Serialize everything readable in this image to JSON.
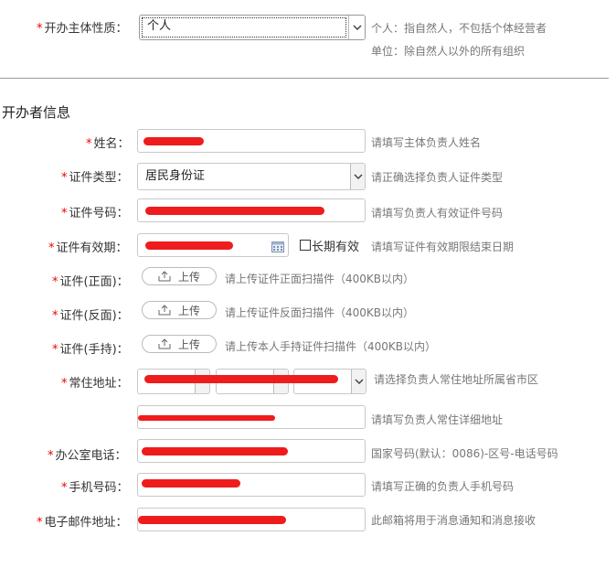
{
  "entity": {
    "label": "开办主体性质：",
    "selected": "个人",
    "hint_person": "个人：指自然人，不包括个体经营者",
    "hint_org": "单位：除自然人以外的所有组织"
  },
  "section_title": "开办者信息",
  "fields": {
    "name": {
      "label": "姓名：",
      "hint": "请填写主体负责人姓名"
    },
    "id_type": {
      "label": "证件类型：",
      "selected": "居民身份证",
      "hint": "请正确选择负责人证件类型"
    },
    "id_number": {
      "label": "证件号码：",
      "hint": "请填写负责人有效证件号码"
    },
    "id_validity": {
      "label": "证件有效期：",
      "long_term": "长期有效",
      "hint": "请填写证件有效期限结束日期"
    },
    "id_front": {
      "label": "证件(正面)：",
      "button": "上传",
      "hint": "请上传证件正面扫描件（400KB以内）"
    },
    "id_back": {
      "label": "证件(反面)：",
      "button": "上传",
      "hint": "请上传证件反面扫描件（400KB以内）"
    },
    "id_hand": {
      "label": "证件(手持)：",
      "button": "上传",
      "hint": "请上传本人手持证件扫描件（400KB以内）"
    },
    "address": {
      "label": "常住地址：",
      "hint_region": "请选择负责人常住地址所属省市区",
      "hint_detail": "请填写负责人常住详细地址"
    },
    "office_phone": {
      "label": "办公室电话：",
      "hint": "国家号码(默认：0086)-区号-电话号码"
    },
    "mobile": {
      "label": "手机号码：",
      "hint": "请填写正确的负责人手机号码"
    },
    "email": {
      "label": "电子邮件地址：",
      "hint": "此邮箱将用于消息通知和消息接收"
    }
  },
  "colors": {
    "required_star": "#ee0000",
    "redaction": "#ee1c1c"
  }
}
